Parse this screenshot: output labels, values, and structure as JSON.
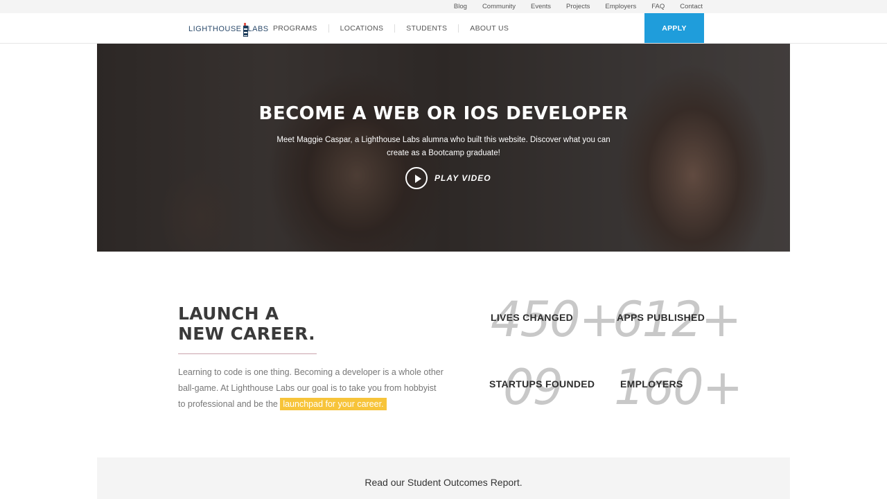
{
  "util_nav": {
    "links": [
      "Blog",
      "Community",
      "Events",
      "Projects",
      "Employers",
      "FAQ",
      "Contact"
    ]
  },
  "main_nav": {
    "logo_left": "LIGHTHOUSE",
    "logo_right": "LABS",
    "items": [
      "PROGRAMS",
      "LOCATIONS",
      "STUDENTS",
      "ABOUT US"
    ],
    "apply_label": "APPLY",
    "apply_color": "#1f9ddb"
  },
  "hero": {
    "title": "BECOME A WEB OR IOS DEVELOPER",
    "subtitle": "Meet Maggie Caspar, a Lighthouse Labs alumna who built this website. Discover what you can create as a Bootcamp graduate!",
    "play_label": "PLAY VIDEO"
  },
  "career": {
    "title_line1": "LAUNCH A",
    "title_line2": "NEW CAREER.",
    "body": "Learning to code is one thing. Becoming a developer is a whole other ball-game. At Lighthouse Labs our goal is to take you from hobbyist to professional and be the ",
    "highlight": "launchpad for your career.",
    "highlight_color": "#f7c43a"
  },
  "stats": [
    {
      "number": "450+",
      "label": "LIVES CHANGED"
    },
    {
      "number": "612+",
      "label": "APPS PUBLISHED"
    },
    {
      "number": "09",
      "label": "STARTUPS FOUNDED"
    },
    {
      "number": "160+",
      "label": "EMPLOYERS"
    }
  ],
  "outcomes": {
    "text": "Read our Student Outcomes Report."
  }
}
